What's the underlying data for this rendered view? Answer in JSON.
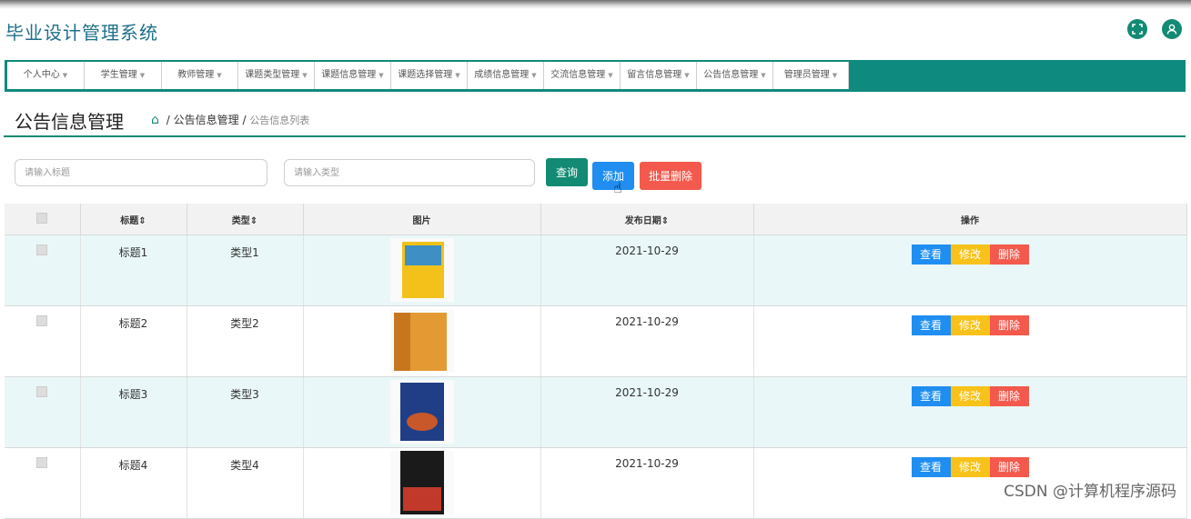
{
  "app": {
    "title": "毕业设计管理系统"
  },
  "header_icons": [
    "fullscreen-icon",
    "user-icon"
  ],
  "nav": {
    "items": [
      {
        "label": "个人中心"
      },
      {
        "label": "学生管理"
      },
      {
        "label": "教师管理"
      },
      {
        "label": "课题类型管理"
      },
      {
        "label": "课题信息管理"
      },
      {
        "label": "课题选择管理"
      },
      {
        "label": "成绩信息管理"
      },
      {
        "label": "交流信息管理"
      },
      {
        "label": "留言信息管理"
      },
      {
        "label": "公告信息管理"
      },
      {
        "label": "管理员管理"
      }
    ]
  },
  "page": {
    "heading": "公告信息管理",
    "breadcrumb": {
      "sep": "/",
      "section": "公告信息管理",
      "current": "公告信息列表"
    }
  },
  "filters": {
    "title_placeholder": "请输入标题",
    "type_placeholder": "请输入类型",
    "query_label": "查询",
    "add_label": "添加",
    "batch_delete_label": "批量删除"
  },
  "table": {
    "columns": [
      "标题",
      "类型",
      "图片",
      "发布日期",
      "操作"
    ],
    "rows": [
      {
        "title": "标题1",
        "type": "类型1",
        "date": "2021-10-29"
      },
      {
        "title": "标题2",
        "type": "类型2",
        "date": "2021-10-29"
      },
      {
        "title": "标题3",
        "type": "类型3",
        "date": "2021-10-29"
      },
      {
        "title": "标题4",
        "type": "类型4",
        "date": "2021-10-29"
      }
    ],
    "actions": {
      "view": "查看",
      "edit": "修改",
      "delete": "删除"
    }
  },
  "watermark": "CSDN @计算机程序源码",
  "colors": {
    "accent": "#138a73",
    "nav_bg": "#0f8a7e",
    "primary": "#1f8ef0",
    "warning": "#f8c21a",
    "danger": "#f3594c",
    "row_alt": "#e9f7f8"
  }
}
